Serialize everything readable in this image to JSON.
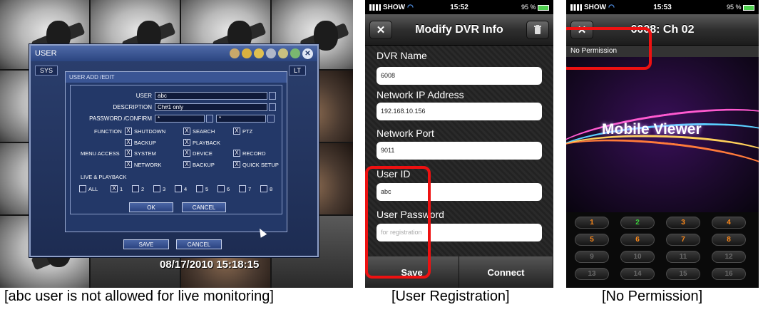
{
  "dvr": {
    "window_title": "USER",
    "tabs": [
      "SYS",
      "LT"
    ],
    "edit_title": "USER ADD /EDIT",
    "fields": {
      "user_label": "USER",
      "user_value": "abc",
      "description_label": "DESCRIPTION",
      "description_value": "Ch#1 only",
      "password_label": "PASSWORD /CONFIRM",
      "password_value": "*",
      "confirm_value": "*"
    },
    "function_label": "FUNCTION",
    "menu_access_label": "MENU ACCESS",
    "function_items": [
      {
        "label": "SHUTDOWN",
        "checked": true
      },
      {
        "label": "SEARCH",
        "checked": true
      },
      {
        "label": "PTZ",
        "checked": true
      },
      {
        "label": "BACKUP",
        "checked": true
      },
      {
        "label": "PLAYBACK",
        "checked": true
      }
    ],
    "menu_items": [
      {
        "label": "SYSTEM",
        "checked": true
      },
      {
        "label": "DEVICE",
        "checked": true
      },
      {
        "label": "RECORD",
        "checked": true
      },
      {
        "label": "NETWORK",
        "checked": true
      },
      {
        "label": "BACKUP",
        "checked": true
      },
      {
        "label": "QUICK SETUP",
        "checked": true
      }
    ],
    "live_playback_label": "LIVE & PLAYBACK",
    "channels": [
      {
        "label": "ALL",
        "checked": false
      },
      {
        "label": "1",
        "checked": true
      },
      {
        "label": "2",
        "checked": false
      },
      {
        "label": "3",
        "checked": false
      },
      {
        "label": "4",
        "checked": false
      },
      {
        "label": "5",
        "checked": false
      },
      {
        "label": "6",
        "checked": false
      },
      {
        "label": "7",
        "checked": false
      },
      {
        "label": "8",
        "checked": false
      }
    ],
    "check_mark": "X",
    "ok_label": "OK",
    "cancel_label": "CANCEL",
    "save_label": "SAVE",
    "cancel2_label": "CANCEL",
    "timestamp": "08/17/2010 15:18:15"
  },
  "phone1": {
    "carrier": "SHOW",
    "time": "15:52",
    "battery": "95 %",
    "nav_title": "Modify DVR Info",
    "close_glyph": "✕",
    "dvr_name_label": "DVR Name",
    "dvr_name_value": "6008",
    "ip_label": "Network IP Address",
    "ip_value": "192.168.10.156",
    "port_label": "Network Port",
    "port_value": "9011",
    "user_id_label": "User ID",
    "user_id_value": "abc",
    "password_label": "User Password",
    "password_placeholder": "for registration",
    "save_label": "Save",
    "connect_label": "Connect"
  },
  "phone2": {
    "carrier": "SHOW",
    "time": "15:53",
    "battery": "95 %",
    "nav_title": "6008: Ch 02",
    "close_glyph": "✕",
    "permission_text": "No Permission",
    "viewer_text": "Mobile Viewer",
    "keys": [
      {
        "label": "1",
        "color": "#ff8a1a"
      },
      {
        "label": "2",
        "color": "#3ad13a"
      },
      {
        "label": "3",
        "color": "#ff8a1a"
      },
      {
        "label": "4",
        "color": "#ff8a1a"
      },
      {
        "label": "5",
        "color": "#ff8a1a"
      },
      {
        "label": "6",
        "color": "#ff8a1a"
      },
      {
        "label": "7",
        "color": "#ff8a1a"
      },
      {
        "label": "8",
        "color": "#ff8a1a"
      },
      {
        "label": "9",
        "color": "#6a6a6a"
      },
      {
        "label": "10",
        "color": "#6a6a6a"
      },
      {
        "label": "11",
        "color": "#6a6a6a"
      },
      {
        "label": "12",
        "color": "#6a6a6a"
      },
      {
        "label": "13",
        "color": "#6a6a6a"
      },
      {
        "label": "14",
        "color": "#6a6a6a"
      },
      {
        "label": "15",
        "color": "#6a6a6a"
      },
      {
        "label": "16",
        "color": "#6a6a6a"
      }
    ]
  },
  "captions": {
    "dvr": "[abc user is not allowed for live monitoring]",
    "registration": "[User Registration]",
    "permission": "[No Permission]"
  },
  "colors": {
    "highlight": "#ee1111",
    "dvr_window": "#2b3f6e"
  }
}
